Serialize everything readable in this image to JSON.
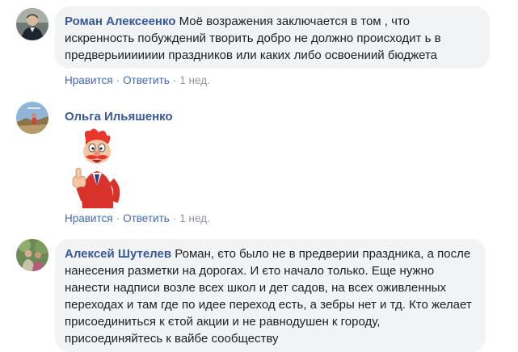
{
  "comments": [
    {
      "author": "Роман Алексеенко",
      "text": "Моё возражения заключается в том , что искренность побуждений творить добро не должно происходит ь в предверьиииииии праздников или каких либо освоениий бюджета",
      "like_label": "Нравится",
      "reply_label": "Ответить",
      "time": "1 нед."
    },
    {
      "author": "Ольга Ильяшенко",
      "sticker": "thumbs-up-cartoon-sticker",
      "like_label": "Нравится",
      "reply_label": "Ответить",
      "time": "1 нед."
    },
    {
      "author": "Алексей Шутелев",
      "text": "Роман, єто было не в предверии праздника, а после нанесения разметки на дорогах. И єто начало только. Еще нужно нанести надписи возле всех школ и дет садов, на всех оживленных переходах и там где по идее переход есть, а зебры нет и тд. Кто желает присоединиться к єтой акции и не равнодушен к городу, присоединяйтесь к вайбе сообществу"
    }
  ],
  "separator": "·",
  "colors": {
    "link": "#385898",
    "action": "#4267b2",
    "meta": "#90949c",
    "bubble": "#f2f3f5",
    "text": "#1c1e21"
  }
}
